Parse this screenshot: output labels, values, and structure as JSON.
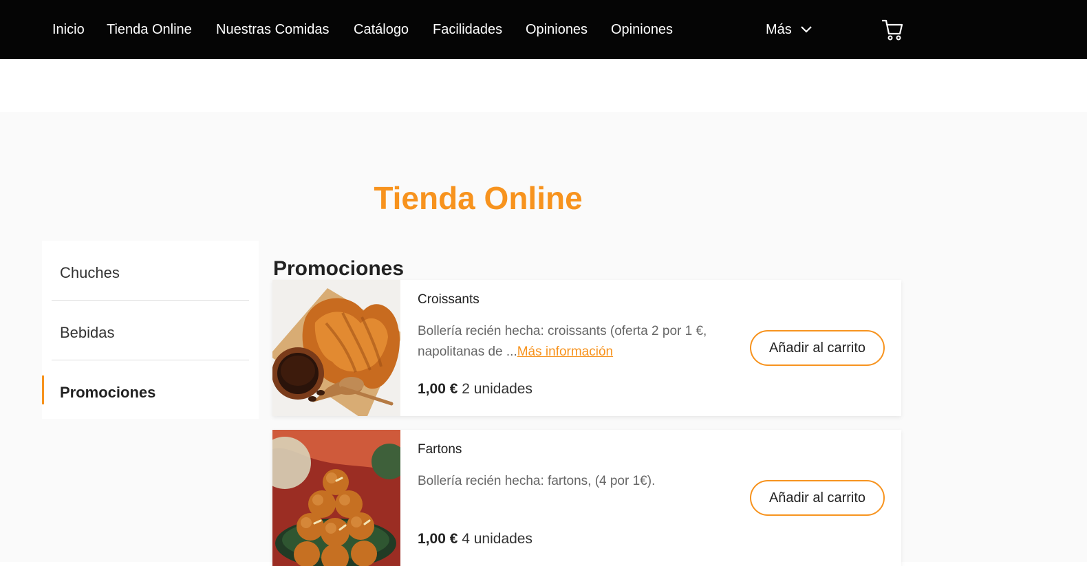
{
  "header": {
    "nav_items": [
      "Inicio",
      "Tienda Online",
      "Nuestras Comidas",
      "Catálogo",
      "Facilidades",
      "Opiniones",
      "Opiniones"
    ],
    "more_label": "Más",
    "cart_icon": "cart-icon"
  },
  "store": {
    "title": "Tienda Online",
    "categories": [
      {
        "label": "Chuches",
        "active": false
      },
      {
        "label": "Bebidas",
        "active": false
      },
      {
        "label": "Promociones",
        "active": true
      }
    ],
    "section_heading": "Promociones",
    "products": [
      {
        "name": "Croissants",
        "description": "Bollería recién hecha: croissants (oferta 2 por 1 €, napolitanas de ...",
        "more_label": "Más información",
        "price": "1,00 €",
        "units": "2 unidades",
        "button_label": "Añadir al carrito"
      },
      {
        "name": "Fartons",
        "description": "Bollería recién hecha: fartons, (4 por 1€).",
        "price": "1,00 €",
        "units": "4 unidades",
        "button_label": "Añadir al carrito"
      }
    ]
  },
  "colors": {
    "accent": "#f7931e",
    "topbar": "#050505",
    "section_background": "#fafafa"
  }
}
